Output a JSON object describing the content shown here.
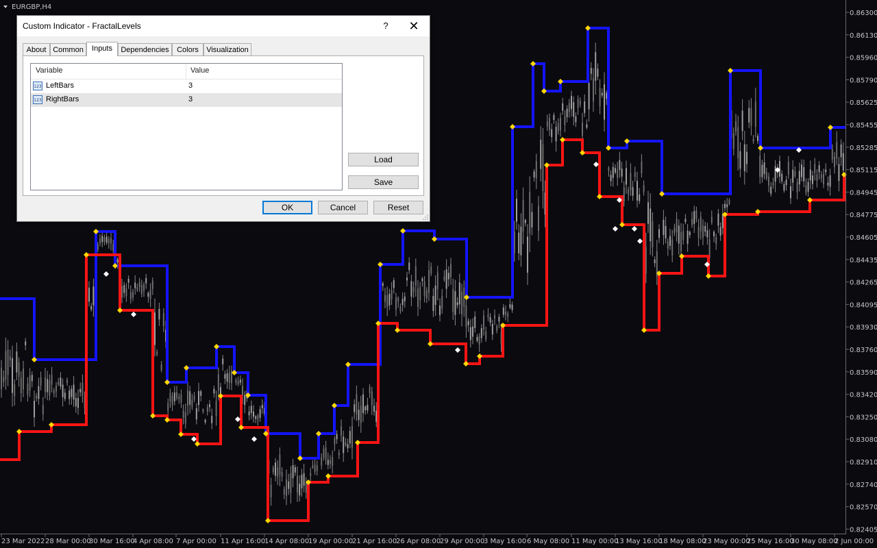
{
  "chart": {
    "symbol_label": "EURGBP,H4",
    "price_labels": [
      "0.86300",
      "0.86130",
      "0.85960",
      "0.85790",
      "0.85625",
      "0.85455",
      "0.85285",
      "0.85115",
      "0.84945",
      "0.84775",
      "0.84605",
      "0.84435",
      "0.84265",
      "0.84095",
      "0.83930",
      "0.83760",
      "0.83590",
      "0.83420",
      "0.83250",
      "0.83080",
      "0.82910",
      "0.82740",
      "0.82570",
      "0.82405"
    ],
    "time_labels": [
      "23 Mar 2022",
      "28 Mar 00:00",
      "30 Mar 16:00",
      "4 Apr 08:00",
      "7 Apr 00:00",
      "11 Apr 16:00",
      "14 Apr 08:00",
      "19 Apr 00:00",
      "21 Apr 16:00",
      "26 Apr 08:00",
      "29 Apr 00:00",
      "3 May 16:00",
      "6 May 08:00",
      "11 May 00:00",
      "13 May 16:00",
      "18 May 08:00",
      "23 May 00:00",
      "25 May 16:00",
      "30 May 08:00",
      "2 Jun 00:00"
    ],
    "colors": {
      "background": "#0a0a0f",
      "upper_level": "#1414ff",
      "lower_level": "#ff1414",
      "fractal_marker": "#ffd700",
      "candles": "#8a8a8a",
      "white_marker": "#ffffff"
    }
  },
  "dialog": {
    "title": "Custom Indicator - FractalLevels",
    "help_glyph": "?",
    "close_glyph": "✕",
    "tabs": [
      {
        "label": "About"
      },
      {
        "label": "Common"
      },
      {
        "label": "Inputs"
      },
      {
        "label": "Dependencies"
      },
      {
        "label": "Colors"
      },
      {
        "label": "Visualization"
      }
    ],
    "active_tab": "Inputs",
    "table": {
      "headers": [
        "Variable",
        "Value"
      ],
      "rows": [
        {
          "icon": "123",
          "variable": "LeftBars",
          "value": "3"
        },
        {
          "icon": "123",
          "variable": "RightBars",
          "value": "3"
        }
      ]
    },
    "side_buttons": {
      "load": "Load",
      "save": "Save"
    },
    "footer_buttons": {
      "ok": "OK",
      "cancel": "Cancel",
      "reset": "Reset"
    }
  }
}
